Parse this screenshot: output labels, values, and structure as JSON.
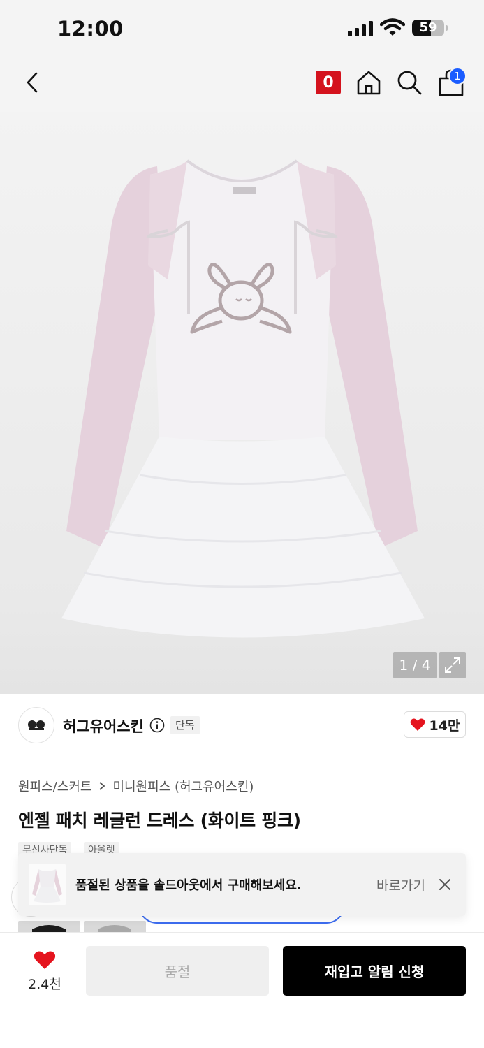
{
  "status_bar": {
    "time": "12:00",
    "battery": "59",
    "battery_level": 0.59
  },
  "header": {
    "counter_badge": "0",
    "cart_count": "1"
  },
  "gallery": {
    "counter": "1 / 4",
    "current": 1,
    "total": 4
  },
  "brand": {
    "name": "허그유어스킨",
    "badge": "단독",
    "likes": "14만"
  },
  "breadcrumb": [
    "원피스/스커트",
    "미니원피스 (허그유어스킨)"
  ],
  "product": {
    "title": "엔젤 패치 레글런 드레스 (화이트 핑크)",
    "tags": [
      "무신사단독",
      "아울렛"
    ]
  },
  "toast": {
    "message": "품절된 상품을 솔드아웃에서 구매해보세요.",
    "link": "바로가기"
  },
  "bottom": {
    "wish_count": "2.4천",
    "soldout_label": "품절",
    "restock_label": "재입고 알림 신청"
  },
  "colors": {
    "accent_red": "#d4121d",
    "badge_blue": "#1a5cff",
    "heart": "#e5141e"
  },
  "icons": [
    "back-icon",
    "home-icon",
    "search-icon",
    "bag-icon",
    "expand-icon",
    "info-icon",
    "heart-icon",
    "close-icon",
    "chevron-right-icon"
  ]
}
